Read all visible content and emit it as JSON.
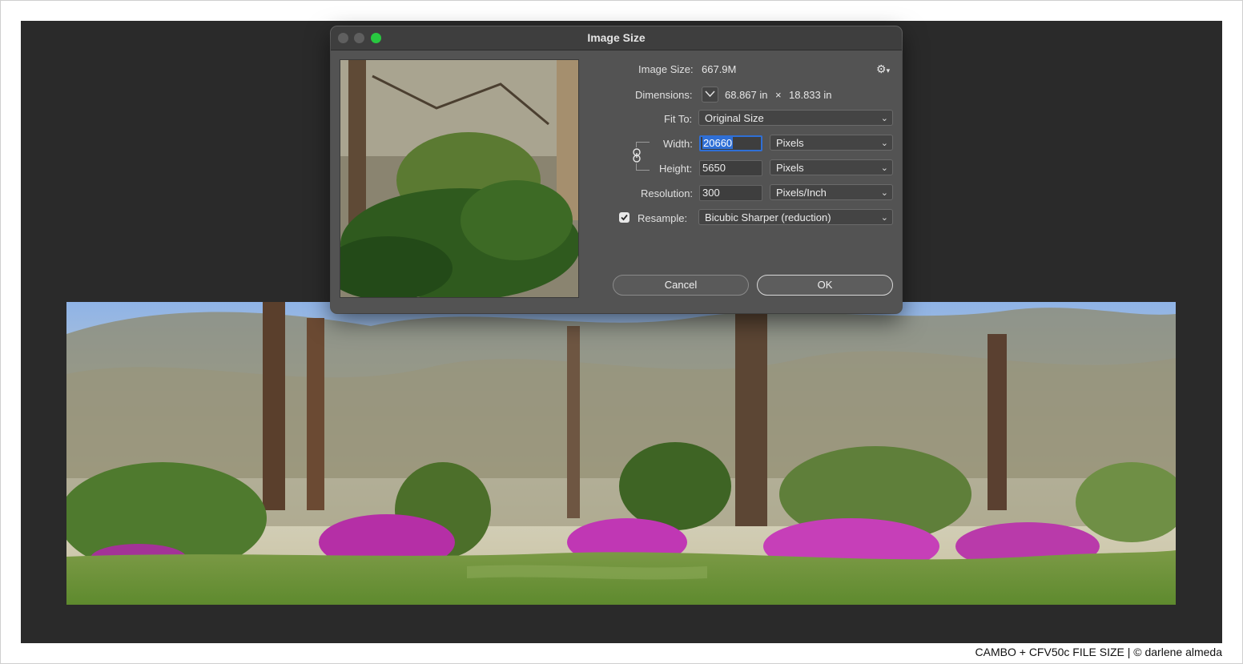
{
  "caption": "CAMBO + CFV50c FILE SIZE | © darlene almeda",
  "dialog": {
    "title": "Image Size",
    "image_size_label": "Image Size:",
    "image_size_value": "667.9M",
    "gear_icon": "gear-icon",
    "dimensions_label": "Dimensions:",
    "dimensions_width": "68.867 in",
    "dimensions_times": "×",
    "dimensions_height": "18.833 in",
    "fit_to_label": "Fit To:",
    "fit_to_value": "Original Size",
    "width_label": "Width:",
    "width_value": "20660",
    "width_unit": "Pixels",
    "height_label": "Height:",
    "height_value": "5650",
    "height_unit": "Pixels",
    "resolution_label": "Resolution:",
    "resolution_value": "300",
    "resolution_unit": "Pixels/Inch",
    "resample_label": "Resample:",
    "resample_checked": true,
    "resample_value": "Bicubic Sharper (reduction)",
    "cancel_label": "Cancel",
    "ok_label": "OK"
  },
  "colors": {
    "backdrop": "#2a2a2a",
    "dialog_bg": "#535353",
    "accent_blue": "#2f6fd6",
    "traffic_green": "#28c840"
  }
}
